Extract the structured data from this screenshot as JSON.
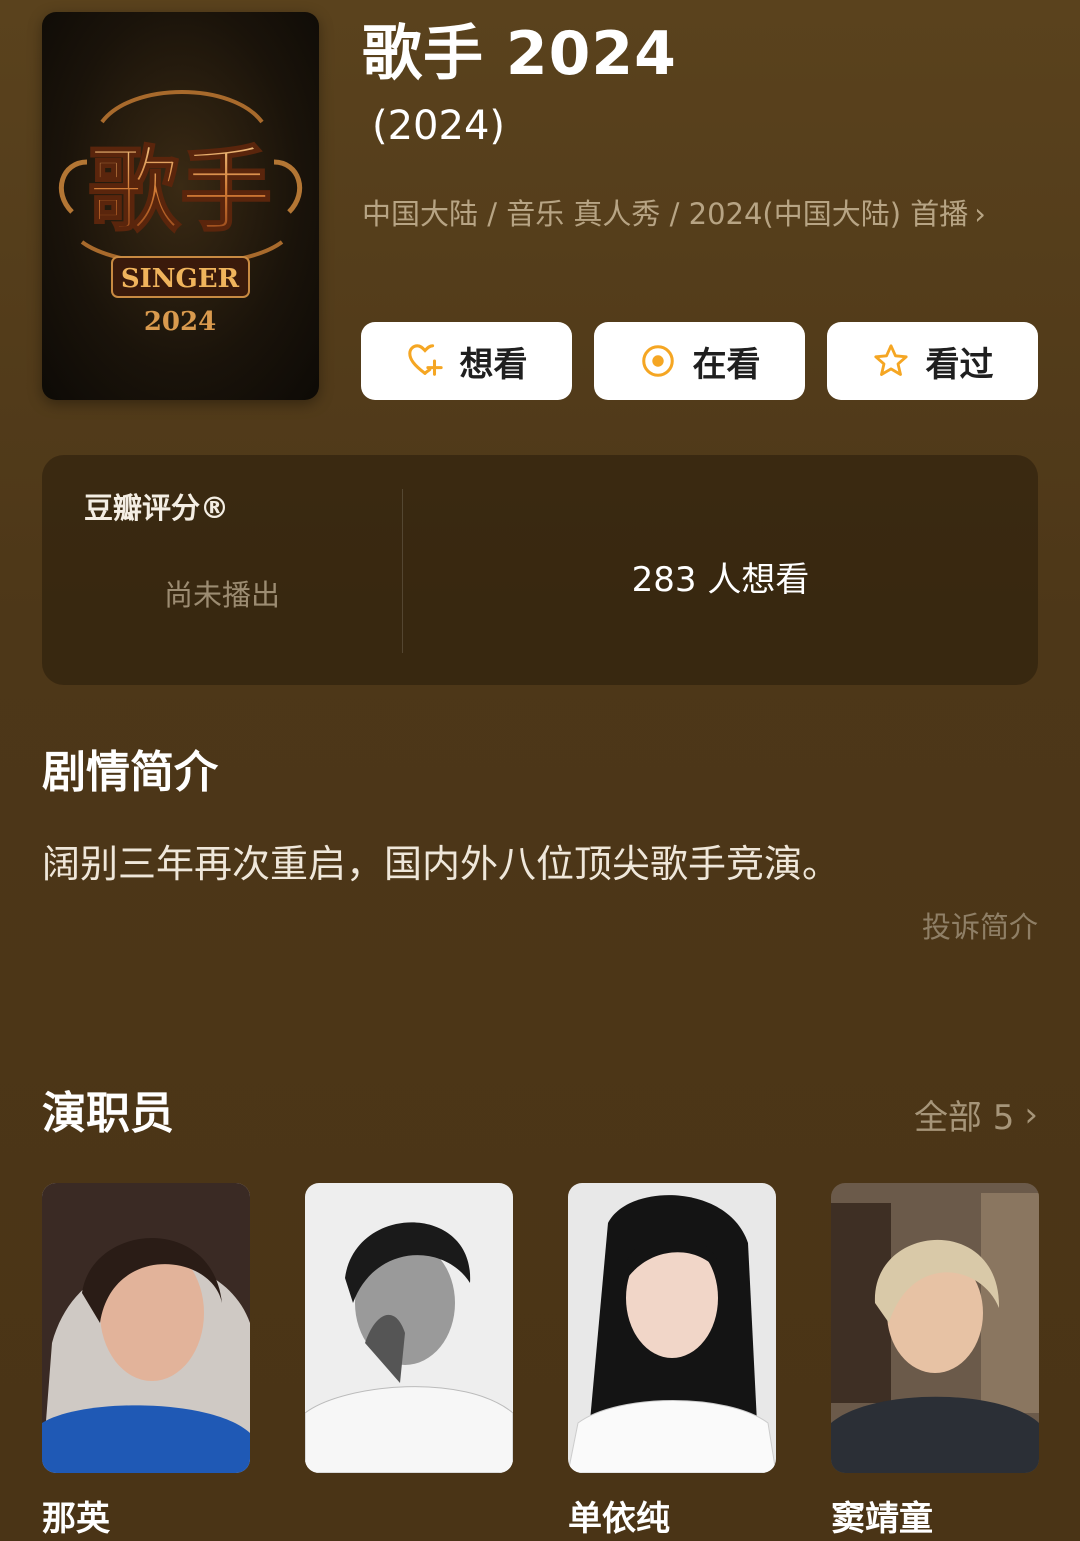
{
  "header": {
    "title": "歌手 2024",
    "year": "(2024)",
    "meta": "中国大陆 / 音乐 真人秀 / 2024(中国大陆) 首播",
    "chevron": "›"
  },
  "poster": {
    "logo_text": "歌手",
    "logo_subtext": "SINGER",
    "logo_year": "2024",
    "accent": "#d98a3a"
  },
  "actions": {
    "want_label": "想看",
    "watching_label": "在看",
    "watched_label": "看过",
    "icon_color": "#f5a623",
    "icons": [
      "heart-plus-icon",
      "target-circle-icon",
      "star-icon"
    ]
  },
  "rating": {
    "label": "豆瓣评分®",
    "status": "尚未播出",
    "want_count": "283 人想看"
  },
  "synopsis": {
    "title": "剧情简介",
    "text": "阔别三年再次重启，国内外八位顶尖歌手竞演。",
    "complain": "投诉简介"
  },
  "cast": {
    "title": "演职员",
    "all_label": "全部 5",
    "members": [
      {
        "name": "那英"
      },
      {
        "name": ""
      },
      {
        "name": "单依纯"
      },
      {
        "name": "窦靖童"
      }
    ]
  }
}
